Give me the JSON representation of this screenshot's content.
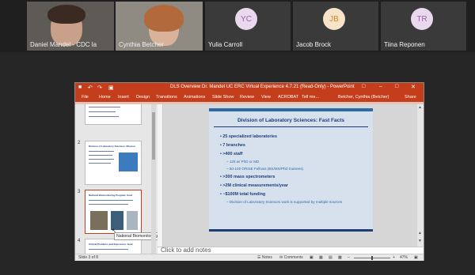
{
  "participants": [
    {
      "name": "Daniel Mandel - CDC la",
      "type": "video"
    },
    {
      "name": "Cynthia Betcher",
      "type": "video"
    },
    {
      "name": "Yulia Carroll",
      "type": "avatar",
      "initials": "YC",
      "circle_color": "#ead8ee",
      "text_color": "#9a62a5"
    },
    {
      "name": "Jacob Brock",
      "type": "avatar",
      "initials": "JB",
      "circle_color": "#f7e3c8",
      "text_color": "#c9893a"
    },
    {
      "name": "Tiina Reponen",
      "type": "avatar",
      "initials": "TR",
      "circle_color": "#ead8ee",
      "text_color": "#9a62a5"
    }
  ],
  "window": {
    "title": "DLS Overview Dr. Mandel UC ERC Virtual Experience 4.7.21 (Read-Only) - PowerPoint",
    "accent": "#c43e1c",
    "menu": [
      "File",
      "Home",
      "Insert",
      "Design",
      "Transitions",
      "Animations",
      "Slide Show",
      "Review",
      "View",
      "ACROBAT",
      "Tell me..."
    ],
    "user": "Betcher, Cynthia (Betcher)",
    "share": "Share"
  },
  "thumbnails": [
    {
      "number": "2",
      "title": "Division of Laboratory Sciences: Mission"
    },
    {
      "number": "3",
      "title": "National Biomonitoring Program: Goal"
    },
    {
      "number": "4",
      "title": "Critical Problems and Exposures: Goal"
    }
  ],
  "tooltip": "National Biomonitoring Program G...",
  "slide": {
    "title": "Division of Laboratory Sciences: Fast Facts",
    "bullets": [
      {
        "text": "25 specialized laboratories",
        "sub": false
      },
      {
        "text": "7 branches",
        "sub": false
      },
      {
        "text": ">400 staff",
        "sub": false
      },
      {
        "text": "125 w/ PhD or MD",
        "sub": true
      },
      {
        "text": "50-100 ORISE Fellows (BS/MS/PhD trainees)",
        "sub": true
      },
      {
        "text": ">300 mass spectrometers",
        "sub": false
      },
      {
        "text": ">2M clinical measurements/year",
        "sub": false
      },
      {
        "text": "~$100M total funding",
        "sub": false
      },
      {
        "text": "Division of Laboratory Sciences work is supported by multiple sources",
        "sub": true
      }
    ]
  },
  "notes_placeholder": "Click to add notes",
  "status": {
    "slide_indicator": "Slide 3 of 8",
    "notes": "Notes",
    "comments": "Comments",
    "zoom": "47%",
    "zoom_level": 0.47
  }
}
